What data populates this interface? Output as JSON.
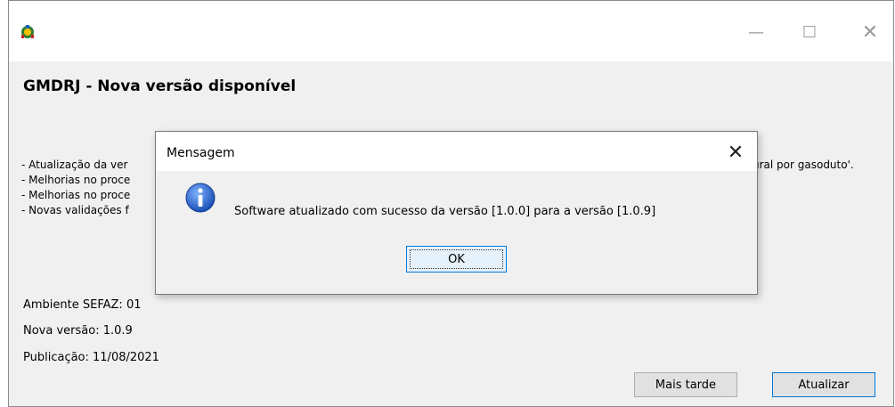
{
  "window": {
    "title": "GMDRJ - Nova versão disponível",
    "controls": {
      "minimize": "—",
      "maximize": "☐",
      "close": "✕"
    }
  },
  "notes": [
    "- Atualização da ver",
    "- Melhorias no proce",
    "- Melhorias no proce",
    "- Novas validações f"
  ],
  "notes_tail": "ural por gasoduto'.",
  "info": {
    "ambiente": "Ambiente SEFAZ: 01",
    "versao": "Nova versão: 1.0.9",
    "publicacao": "Publicação: 11/08/2021"
  },
  "buttons": {
    "later": "Mais tarde",
    "update": "Atualizar"
  },
  "dialog": {
    "title": "Mensagem",
    "close": "✕",
    "message": "Software atualizado com sucesso da versão [1.0.0] para a versão [1.0.9]",
    "ok": "OK",
    "icon": "info-icon"
  },
  "colors": {
    "focus_border": "#0078d7",
    "info_icon": "#1a5fc8"
  }
}
